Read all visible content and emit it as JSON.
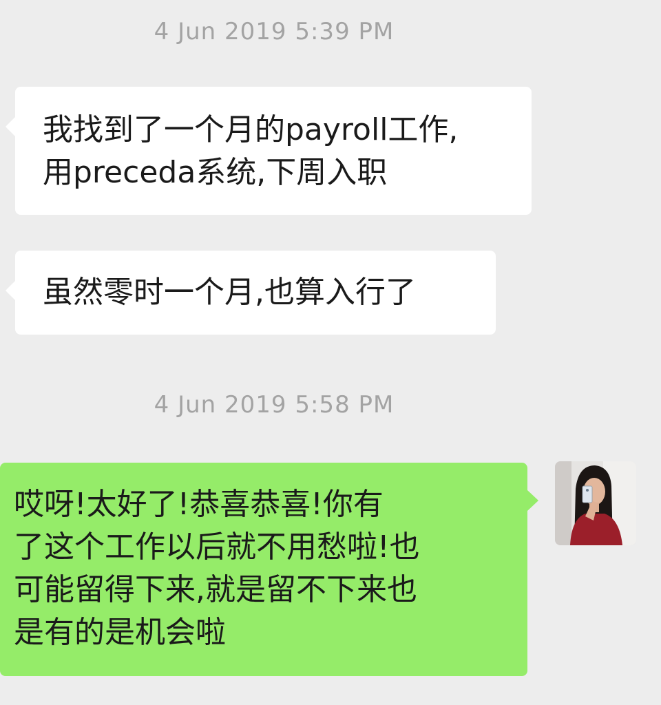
{
  "chat": {
    "timestamps": [
      "4 Jun 2019 5:39 PM",
      "4 Jun 2019 5:58 PM"
    ],
    "messages": [
      {
        "direction": "incoming",
        "lines": [
          "我找到了一个月的payroll工作,",
          "用preceda系统,下周入职"
        ]
      },
      {
        "direction": "incoming",
        "lines": [
          "虽然零时一个月,也算入行了"
        ]
      },
      {
        "direction": "outgoing",
        "lines": [
          "哎呀!太好了!恭喜恭喜!你有",
          "了这个工作以后就不用愁啦!也",
          "可能留得下来,就是留不下来也",
          "是有的是机会啦"
        ]
      }
    ]
  },
  "colors": {
    "background": "#ededed",
    "incoming_bubble": "#ffffff",
    "outgoing_bubble": "#95ec69",
    "timestamp_text": "#a3a3a3"
  },
  "icons": {
    "avatar": "user-avatar-photo"
  }
}
